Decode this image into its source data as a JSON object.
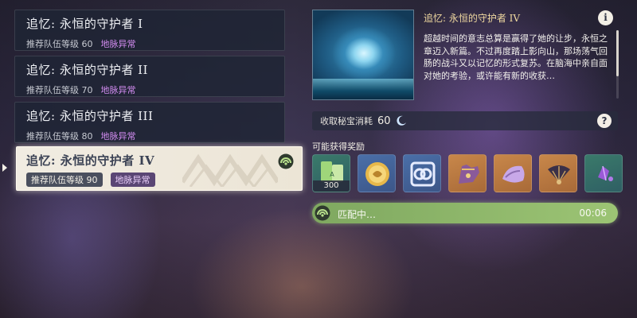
{
  "domains": [
    {
      "title": "追忆: 永恒的守护者 I",
      "level_label": "推荐队伍等级 60",
      "ley_line": "地脉异常",
      "selected": false
    },
    {
      "title": "追忆: 永恒的守护者 II",
      "level_label": "推荐队伍等级 70",
      "ley_line": "地脉异常",
      "selected": false
    },
    {
      "title": "追忆: 永恒的守护者 III",
      "level_label": "推荐队伍等级 80",
      "ley_line": "地脉异常",
      "selected": false
    },
    {
      "title": "追忆: 永恒的守护者 IV",
      "level_label": "推荐队伍等级 90",
      "ley_line": "地脉异常",
      "selected": true
    }
  ],
  "detail": {
    "title": "追忆: 永恒的守护者 IV",
    "description": "超越时间的意志总算是赢得了她的让步，永恒之章迈入新篇。不过再度踏上影向山，那场荡气回肠的战斗又以记忆的形式复苏。在脑海中亲自面对她的考验，或许能有新的收获…"
  },
  "resin": {
    "label": "收取秘宝消耗",
    "value": "60",
    "icon": "original-resin-moon-icon"
  },
  "rewards_label": "可能获得奖励",
  "rewards": [
    {
      "name": "adventure-exp-icon",
      "quantity": "300",
      "bg": "green"
    },
    {
      "name": "mora-coin-icon",
      "quantity": "",
      "bg": "blue"
    },
    {
      "name": "companionship-exp-icon",
      "quantity": "",
      "bg": "blue"
    },
    {
      "name": "boss-material-gauntlet-icon",
      "quantity": "",
      "bg": "gold"
    },
    {
      "name": "artifact-shell-icon",
      "quantity": "",
      "bg": "gold"
    },
    {
      "name": "artifact-fan-icon",
      "quantity": "",
      "bg": "gold"
    },
    {
      "name": "gem-shard-icon",
      "quantity": "",
      "bg": "green"
    }
  ],
  "matching": {
    "label": "匹配中…",
    "time": "00:06"
  },
  "colors": {
    "accent_green": "#9cc474",
    "ley_line_purple": "#d28cf0",
    "title_gold": "#f0d9a0"
  }
}
